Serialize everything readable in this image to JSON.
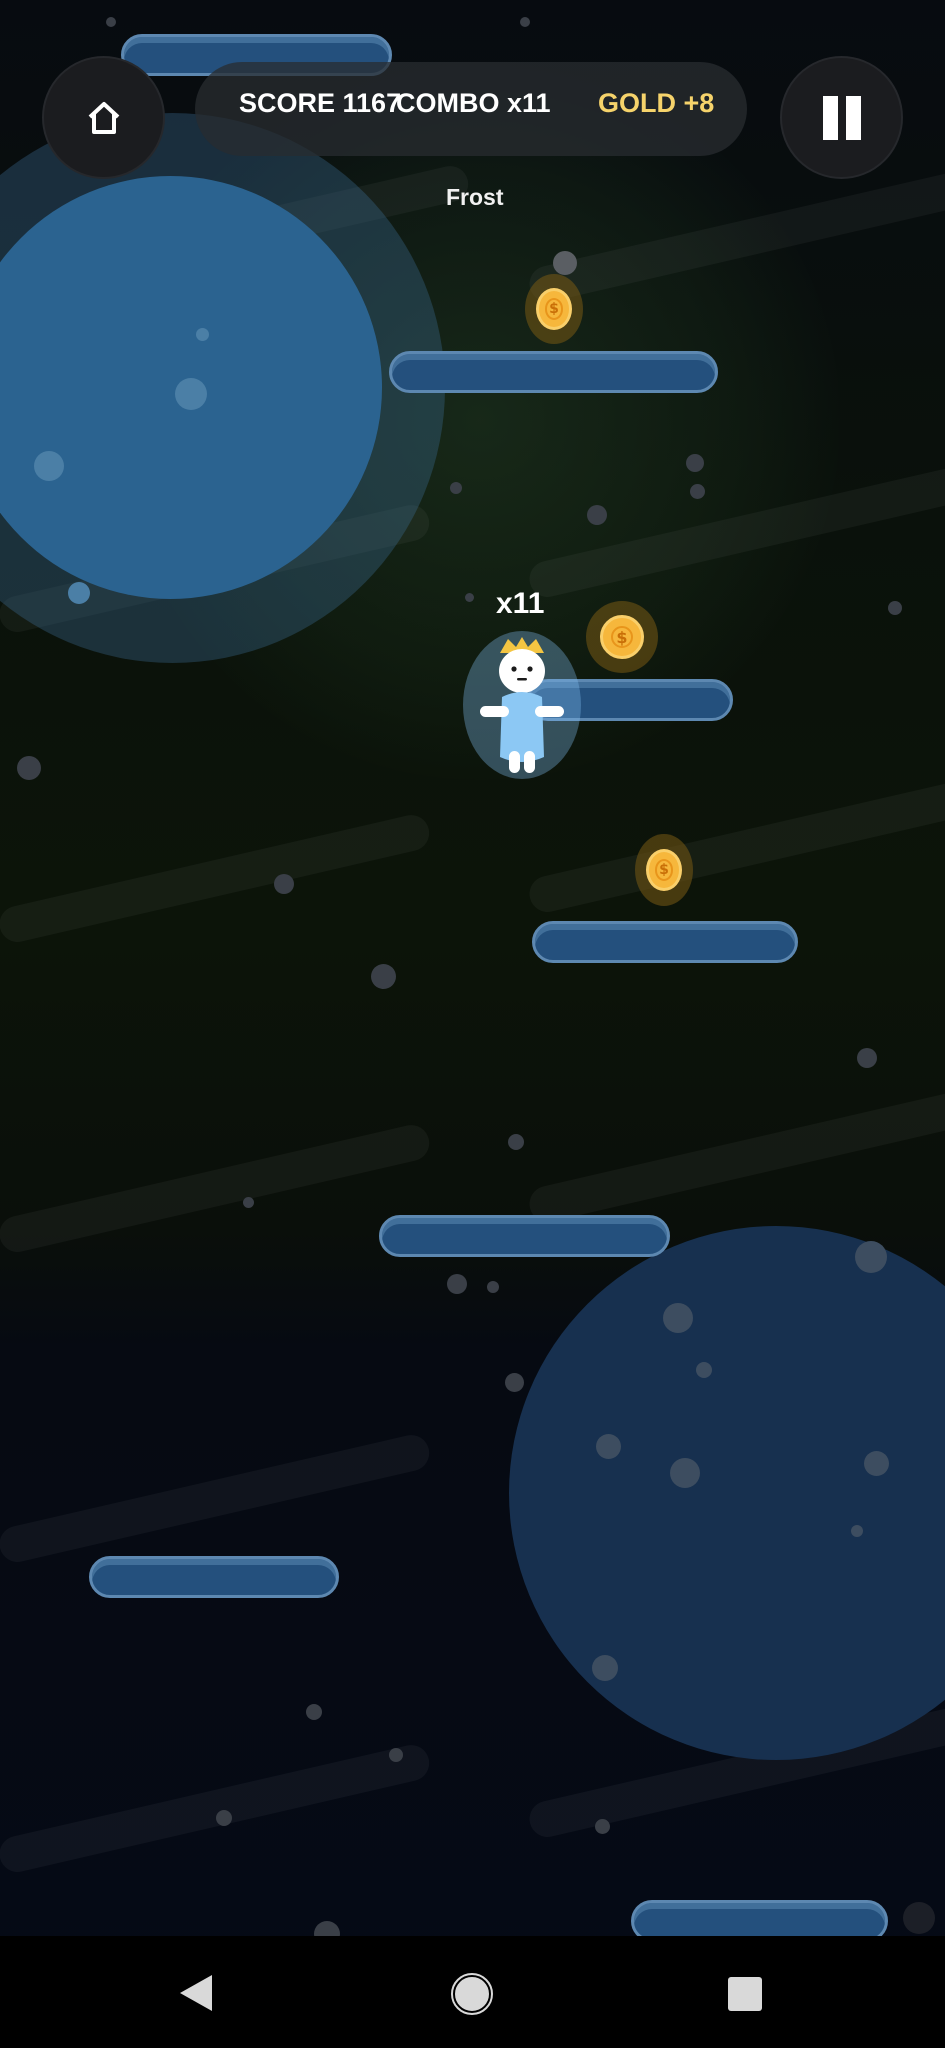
{
  "hud": {
    "score_text": "SCORE 1167",
    "combo_text": "COMBO x11",
    "gold_text": "GOLD +8",
    "home_icon": "home-icon",
    "pause_icon": "pause-icon"
  },
  "zone": {
    "name": "Frost"
  },
  "player": {
    "combo_popup": "x11",
    "costume": "ice-cat-with-crown"
  },
  "coin": {
    "symbol": "$"
  },
  "nav": {
    "back_icon": "back-triangle-icon",
    "home_icon": "home-circle-icon",
    "recents_icon": "recents-square-icon"
  },
  "colors": {
    "gold": "#f6d36b",
    "platform": "#24507d",
    "planet": "#2b6390"
  }
}
